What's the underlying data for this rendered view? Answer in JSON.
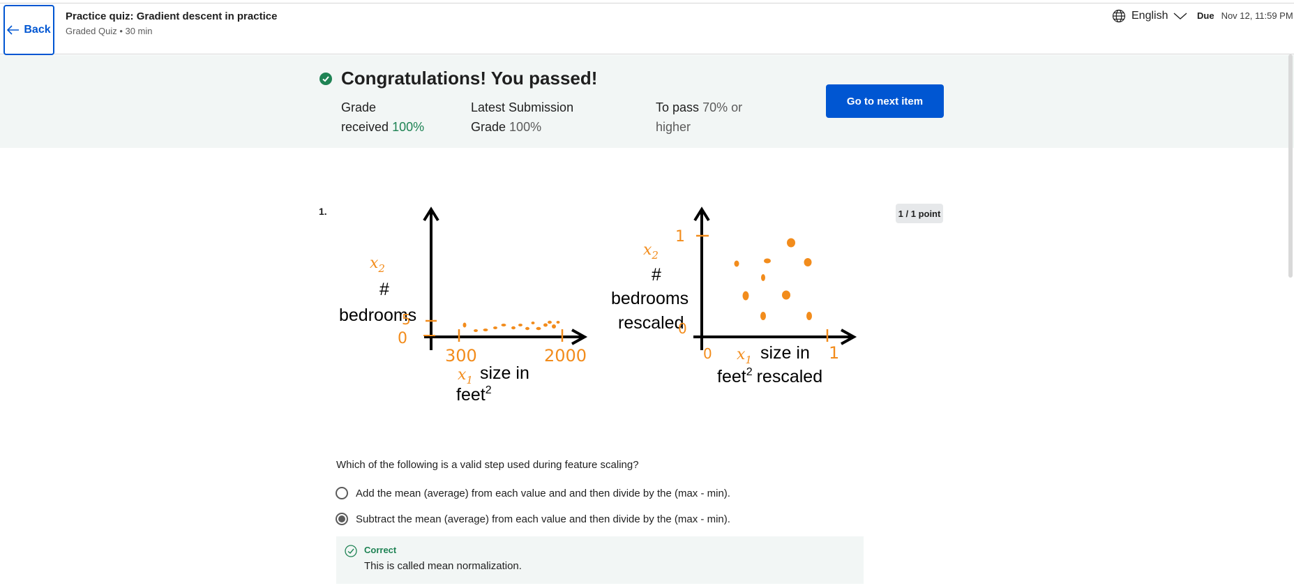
{
  "header": {
    "back_label": "Back",
    "quiz_title": "Practice quiz: Gradient descent in practice",
    "quiz_subtitle": "Graded Quiz • 30 min",
    "language": "English",
    "due_label": "Due",
    "due_date": "Nov 12, 11:59 PM +"
  },
  "result": {
    "heading": "Congratulations! You passed!",
    "grade_received_label_1": "Grade",
    "grade_received_label_2": "received",
    "grade_received_value": "100%",
    "latest_label_1": "Latest Submission",
    "latest_label_2": "Grade",
    "latest_value": "100%",
    "to_pass_label": "To pass",
    "to_pass_value_1": "70% or",
    "to_pass_value_2": "higher",
    "next_button": "Go to next item",
    "status_color": "#1f8354"
  },
  "question": {
    "number": "1.",
    "points": "1 / 1 point",
    "figure": {
      "left": {
        "y_var": "x",
        "y_sub": "2",
        "y_label_1": "#",
        "y_label_2": "bedrooms",
        "y_tick_low": "0",
        "y_tick_high": "5",
        "x_tick_low": "300",
        "x_tick_high": "2000",
        "x_var": "x",
        "x_sub": "1",
        "x_label_1": "size in",
        "x_label_2": "feet",
        "x_label_sup": "2"
      },
      "right": {
        "y_var": "x",
        "y_sub": "2",
        "y_label_1": "#",
        "y_label_2": "bedrooms",
        "y_label_3": "rescaled",
        "y_tick_low": "0",
        "y_tick_high": "1",
        "x_tick_low": "0",
        "x_tick_high": "1",
        "x_var": "x",
        "x_sub": "1",
        "x_label_1": "size in",
        "x_label_2": "feet",
        "x_label_sup": "2",
        "x_label_3": "rescaled"
      },
      "annotation_color": "#f28c1c"
    },
    "prompt": "Which of the following is a valid step used during feature scaling?",
    "options": [
      {
        "label": "Add the mean (average) from each value and and then divide by the (max - min).",
        "selected": false
      },
      {
        "label": "Subtract the mean (average) from each value and then divide by the (max - min).",
        "selected": true
      }
    ],
    "feedback": {
      "title": "Correct",
      "text": "This is called mean normalization."
    }
  },
  "colors": {
    "primary": "#0056d2",
    "success": "#1f8354",
    "banner_bg": "#f2f6f5"
  }
}
